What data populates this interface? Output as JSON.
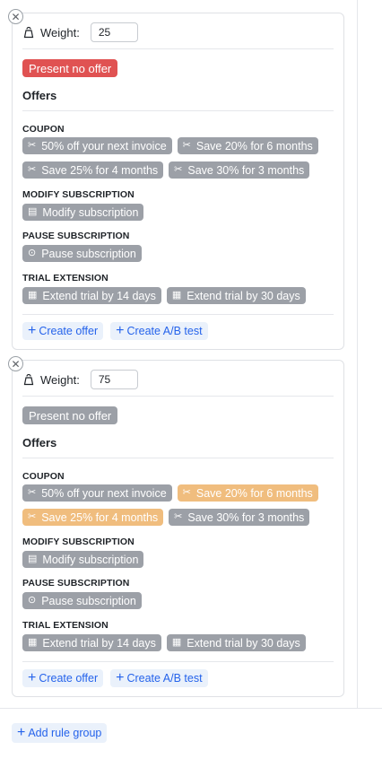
{
  "groups": [
    {
      "weight_label": "Weight:",
      "weight_value": "25",
      "no_offer_label": "Present no offer",
      "no_offer_active": true,
      "offers_title": "Offers",
      "categories": {
        "coupon": "COUPON",
        "modify": "MODIFY SUBSCRIPTION",
        "pause": "PAUSE SUBSCRIPTION",
        "trial": "TRIAL EXTENSION"
      },
      "offers": {
        "coupon_50": "50% off your next invoice",
        "coupon_20": "Save 20% for 6 months",
        "coupon_25": "Save 25% for 4 months",
        "coupon_30": "Save 30% for 3 months",
        "modify": "Modify subscription",
        "pause": "Pause subscription",
        "trial_14": "Extend trial by 14 days",
        "trial_30": "Extend trial by 30 days"
      },
      "selected": [],
      "create_offer": "Create offer",
      "create_ab": "Create A/B test"
    },
    {
      "weight_label": "Weight:",
      "weight_value": "75",
      "no_offer_label": "Present no offer",
      "no_offer_active": false,
      "offers_title": "Offers",
      "categories": {
        "coupon": "COUPON",
        "modify": "MODIFY SUBSCRIPTION",
        "pause": "PAUSE SUBSCRIPTION",
        "trial": "TRIAL EXTENSION"
      },
      "offers": {
        "coupon_50": "50% off your next invoice",
        "coupon_20": "Save 20% for 6 months",
        "coupon_25": "Save 25% for 4 months",
        "coupon_30": "Save 30% for 3 months",
        "modify": "Modify subscription",
        "pause": "Pause subscription",
        "trial_14": "Extend trial by 14 days",
        "trial_30": "Extend trial by 30 days"
      },
      "selected": [
        "coupon_20",
        "coupon_25"
      ],
      "create_offer": "Create offer",
      "create_ab": "Create A/B test"
    }
  ],
  "add_rule_group": "Add rule group",
  "colors": {
    "no_offer_active": "#e05252",
    "chip_default": "#9ca0a7",
    "chip_selected": "#f0bd7e",
    "link": "#2563eb",
    "link_bg": "#eaf1fb"
  },
  "icons": {
    "close": "close-icon",
    "weight": "weight-icon",
    "coupon": "scissors-icon",
    "modify": "document-icon",
    "pause": "pause-icon",
    "trial": "calendar-icon",
    "plus": "plus-icon"
  }
}
